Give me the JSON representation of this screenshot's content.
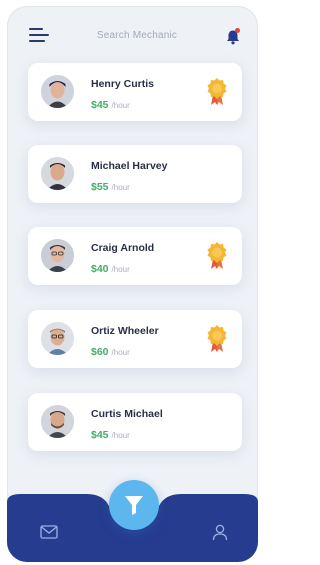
{
  "header": {
    "title": "Search Mechanic",
    "menu_icon": "hamburger-menu-icon",
    "notification_icon": "bell-icon",
    "notification_dot_color": "#e2463f"
  },
  "mechanics": [
    {
      "name": "Henry Curtis",
      "price": "$45",
      "unit": "/hour",
      "badge": true,
      "avatar": "avatar-henry-curtis"
    },
    {
      "name": "Michael Harvey",
      "price": "$55",
      "unit": "/hour",
      "badge": false,
      "avatar": "avatar-michael-harvey"
    },
    {
      "name": "Craig Arnold",
      "price": "$40",
      "unit": "/hour",
      "badge": true,
      "avatar": "avatar-craig-arnold"
    },
    {
      "name": "Ortiz Wheeler",
      "price": "$60",
      "unit": "/hour",
      "badge": true,
      "avatar": "avatar-ortiz-wheeler"
    },
    {
      "name": "Curtis Michael",
      "price": "$45",
      "unit": "/hour",
      "badge": false,
      "avatar": "avatar-curtis-michael"
    }
  ],
  "bottom_nav": {
    "left_icon": "mail-icon",
    "center_icon": "filter-icon",
    "right_icon": "user-icon"
  },
  "colors": {
    "nav_bar": "#263c8f",
    "price": "#3fae6a",
    "filter_button": "#5cb7ee",
    "badge": "#f5b632"
  }
}
